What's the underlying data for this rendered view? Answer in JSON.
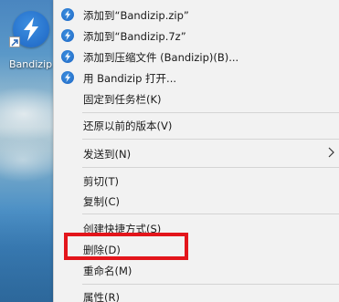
{
  "desktop": {
    "icon_label": "Bandizip"
  },
  "menu": {
    "items": [
      {
        "label": "添加到“Bandizip.zip”",
        "icon": "bandizip-icon"
      },
      {
        "label": "添加到“Bandizip.7z”",
        "icon": "bandizip-icon"
      },
      {
        "label": "添加到压缩文件 (Bandizip)(B)...",
        "icon": "bandizip-icon"
      },
      {
        "label": "用 Bandizip 打开...",
        "icon": "bandizip-icon"
      },
      {
        "label": "固定到任务栏(K)"
      },
      {
        "label": "还原以前的版本(V)"
      },
      {
        "label": "发送到(N)",
        "icon": "chevron-right-icon"
      },
      {
        "label": "剪切(T)"
      },
      {
        "label": "复制(C)"
      },
      {
        "label": "创建快捷方式(S)"
      },
      {
        "label": "删除(D)"
      },
      {
        "label": "重命名(M)"
      },
      {
        "label": "属性(R)"
      }
    ]
  },
  "colors": {
    "highlight": "#e3151b",
    "menu_background": "#f2f2f2",
    "bandizip_blue": "#1d66c4"
  }
}
